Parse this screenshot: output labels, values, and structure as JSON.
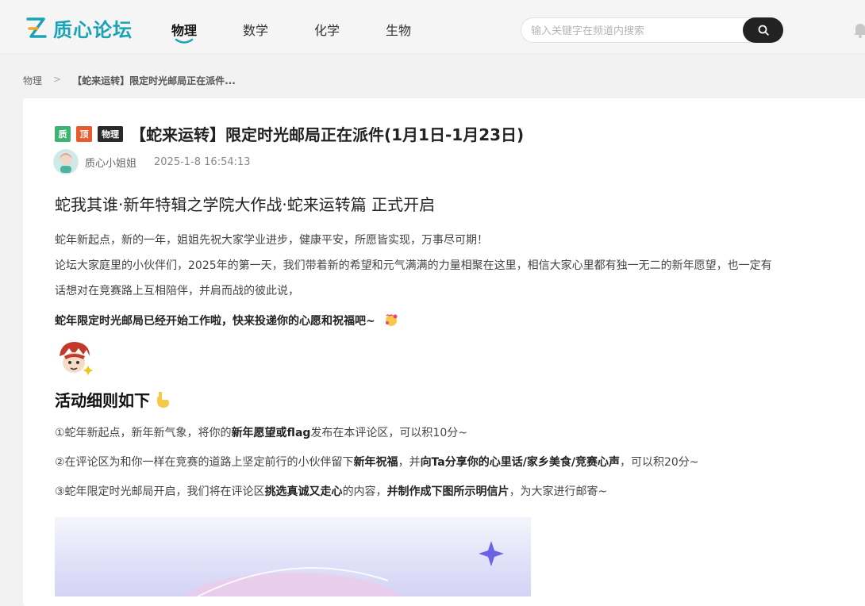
{
  "site": {
    "name": "质心论坛"
  },
  "nav": [
    {
      "label": "物理",
      "active": true
    },
    {
      "label": "数学",
      "active": false
    },
    {
      "label": "化学",
      "active": false
    },
    {
      "label": "生物",
      "active": false
    }
  ],
  "search": {
    "placeholder": "输入关键字在频道内搜索"
  },
  "breadcrumb": {
    "root": "物理",
    "sep": ">",
    "current": "【蛇来运转】限定时光邮局正在派件..."
  },
  "post": {
    "tags": [
      "质",
      "顶",
      "物理"
    ],
    "title": "【蛇来运转】限定时光邮局正在派件(1月1日-1月23日)",
    "author": "质心小姐姐",
    "time": "2025-1-8 16:54:13",
    "heading": "蛇我其谁·新年特辑之学院大作战·蛇来运转篇 正式开启",
    "para1": "蛇年新起点，新的一年，姐姐先祝大家学业进步，健康平安，所愿皆实现，万事尽可期！",
    "para2a": "论坛大家庭里的小伙伴们，2025年的第一天，我们带着新的希望和元气满满的力量相聚在这里，相信大家心里都有独一无二的新年愿望，也一定有",
    "para2b": "话想对在竞赛路上互相陪伴，并肩而战的彼此说，",
    "para3": "蛇年限定时光邮局已经开始工作啦，快来投递你的心愿和祝福吧~",
    "rules_heading": "活动细则如下",
    "rules": [
      {
        "a": "①蛇年新起点，新年新气象，将你的",
        "b": "新年愿望或flag",
        "c": "发布在本评论区，可以积10分~",
        "d": "",
        "e": ""
      },
      {
        "a": "②在评论区为和你一样在竞赛的道路上坚定前行的小伙伴留下",
        "b": "新年祝福",
        "c": "，并",
        "d": "向Ta分享你的心里话/家乡美食/竞赛心声",
        "e": "，可以积20分~"
      },
      {
        "a": "③蛇年限定时光邮局开启，我们将在评论区",
        "b": "挑选真诚又走心",
        "c": "的内容，",
        "d": "并制作成下图所示明信片",
        "e": "，为大家进行邮寄~"
      }
    ]
  },
  "colors": {
    "brand": "#1aa3b5",
    "dark": "#222222",
    "accent_green": "#3cb371",
    "accent_red": "#e85b2e"
  },
  "icons": [
    "logo-z-icon",
    "search-icon",
    "bell-icon",
    "heart-face-emoji",
    "pointing-down-emoji",
    "sparkle-icon"
  ]
}
